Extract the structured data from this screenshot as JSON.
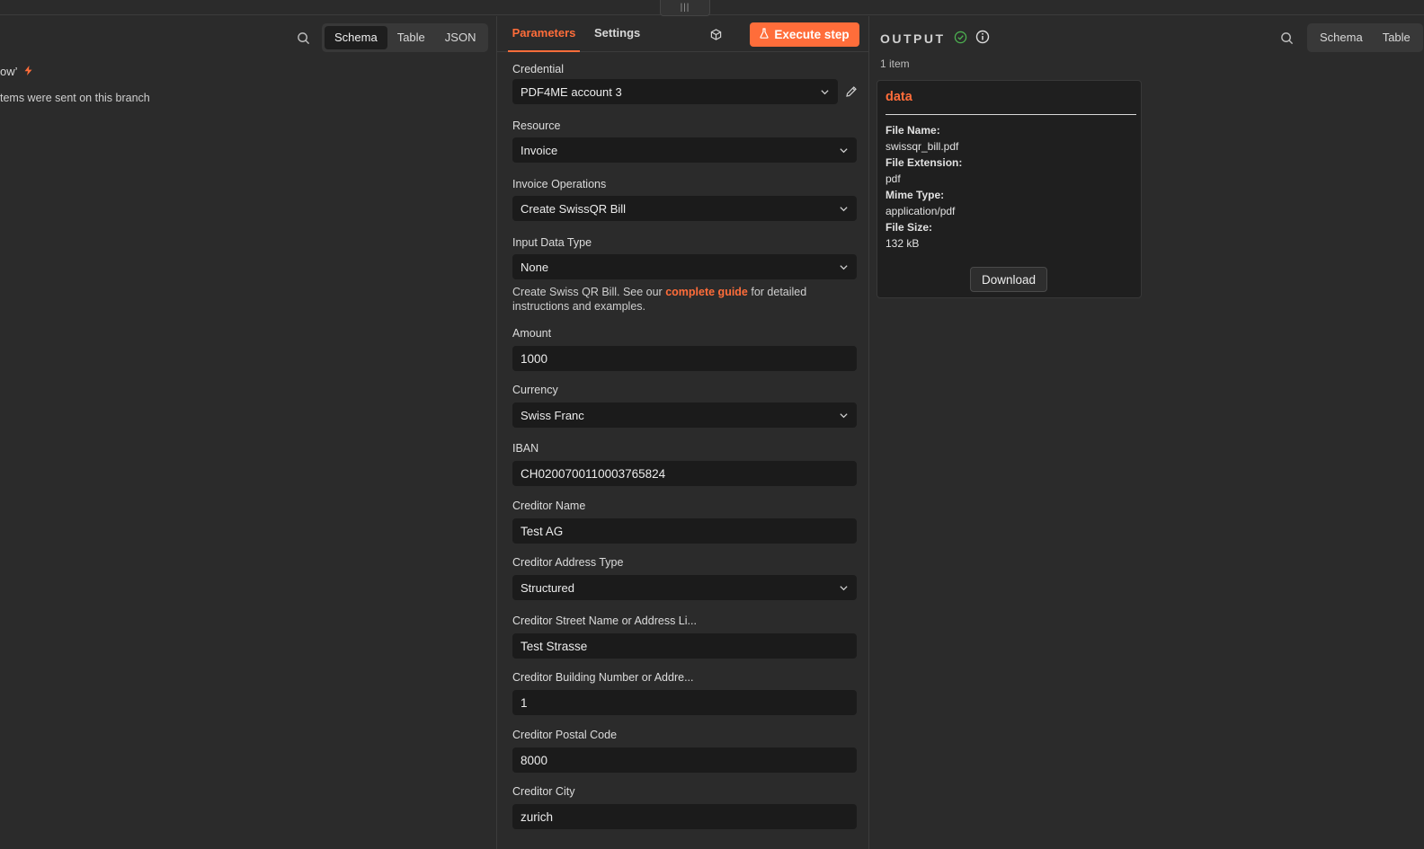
{
  "drag_handle": "|||",
  "input_panel": {
    "views": [
      "Schema",
      "Table",
      "JSON"
    ],
    "trigger_text": "ow’",
    "info_text": "tems were sent on this branch"
  },
  "params_panel": {
    "tabs": [
      "Parameters",
      "Settings"
    ],
    "execute_label": "Execute step",
    "credential": {
      "label": "Credential",
      "value": "PDF4ME account 3"
    },
    "resource": {
      "label": "Resource",
      "value": "Invoice"
    },
    "operation": {
      "label": "Invoice Operations",
      "value": "Create SwissQR Bill"
    },
    "input_type": {
      "label": "Input Data Type",
      "value": "None"
    },
    "hint": {
      "before": "Create Swiss QR Bill. See our ",
      "link": "complete guide",
      "after": " for detailed instructions and examples."
    },
    "amount": {
      "label": "Amount",
      "value": "1000"
    },
    "currency": {
      "label": "Currency",
      "value": "Swiss Franc"
    },
    "iban": {
      "label": "IBAN",
      "value": "CH0200700110003765824"
    },
    "creditor_name": {
      "label": "Creditor Name",
      "value": "Test AG"
    },
    "creditor_address_type": {
      "label": "Creditor Address Type",
      "value": "Structured"
    },
    "creditor_street": {
      "label": "Creditor Street Name or Address Li...",
      "value": "Test Strasse"
    },
    "creditor_building": {
      "label": "Creditor Building Number or Addre...",
      "value": "1"
    },
    "creditor_postal": {
      "label": "Creditor Postal Code",
      "value": "8000"
    },
    "creditor_city": {
      "label": "Creditor City",
      "value": "zurich"
    }
  },
  "output_panel": {
    "title": "OUTPUT",
    "item_count": "1 item",
    "views": [
      "Schema",
      "Table"
    ],
    "card": {
      "title": "data",
      "fields": [
        {
          "key": "File Name:",
          "value": "swissqr_bill.pdf"
        },
        {
          "key": "File Extension:",
          "value": "pdf"
        },
        {
          "key": "Mime Type:",
          "value": "application/pdf"
        },
        {
          "key": "File Size:",
          "value": "132 kB"
        }
      ],
      "download_label": "Download"
    }
  },
  "colors": {
    "accent": "#ff6d3a",
    "success": "#4caf50",
    "panel_bg": "#2b2b2b",
    "field_bg": "#1b1b1b"
  },
  "icons": [
    "search-icon",
    "cube-icon",
    "flask-icon",
    "chevron-down-icon",
    "pencil-icon",
    "check-circle-icon",
    "info-icon",
    "bolt-icon"
  ]
}
